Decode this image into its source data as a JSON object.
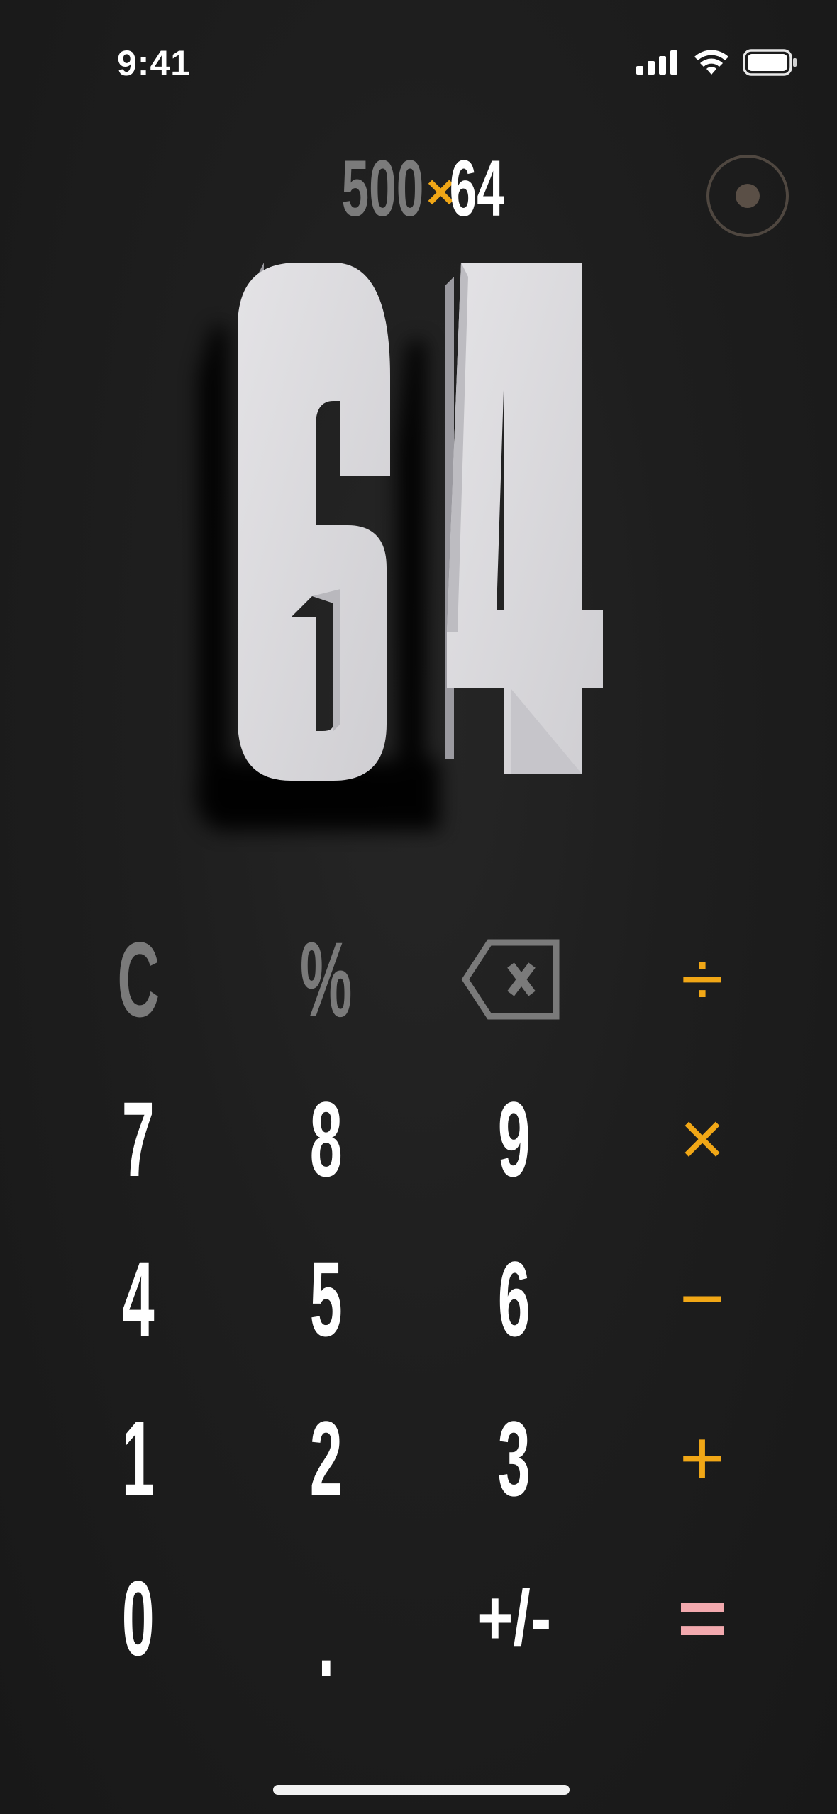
{
  "status_bar": {
    "time": "9:41",
    "icons": [
      "signal-icon",
      "wifi-icon",
      "battery-icon"
    ]
  },
  "expression": {
    "operand_a": "500",
    "operator": "×",
    "operand_b": "64"
  },
  "display": {
    "value": "64"
  },
  "keypad": {
    "row1": [
      {
        "label": "C",
        "kind": "function"
      },
      {
        "label": "%",
        "kind": "function"
      },
      {
        "label": "",
        "kind": "function",
        "icon": "backspace-icon"
      },
      {
        "label": "÷",
        "kind": "operator"
      }
    ],
    "row2": [
      {
        "label": "7",
        "kind": "digit"
      },
      {
        "label": "8",
        "kind": "digit"
      },
      {
        "label": "9",
        "kind": "digit"
      },
      {
        "label": "×",
        "kind": "operator"
      }
    ],
    "row3": [
      {
        "label": "4",
        "kind": "digit"
      },
      {
        "label": "5",
        "kind": "digit"
      },
      {
        "label": "6",
        "kind": "digit"
      },
      {
        "label": "−",
        "kind": "operator"
      }
    ],
    "row4": [
      {
        "label": "1",
        "kind": "digit"
      },
      {
        "label": "2",
        "kind": "digit"
      },
      {
        "label": "3",
        "kind": "digit"
      },
      {
        "label": "+",
        "kind": "operator"
      }
    ],
    "row5": [
      {
        "label": "0",
        "kind": "digit"
      },
      {
        "label": ".",
        "kind": "digit"
      },
      {
        "label": "+/-",
        "kind": "digit"
      },
      {
        "label": "=",
        "kind": "equals"
      }
    ]
  },
  "colors": {
    "background": "#1b1b1b",
    "operator": "#f1a716",
    "equals": "#f2a9ae",
    "function": "#7a7a7a",
    "digit": "#ffffff"
  }
}
